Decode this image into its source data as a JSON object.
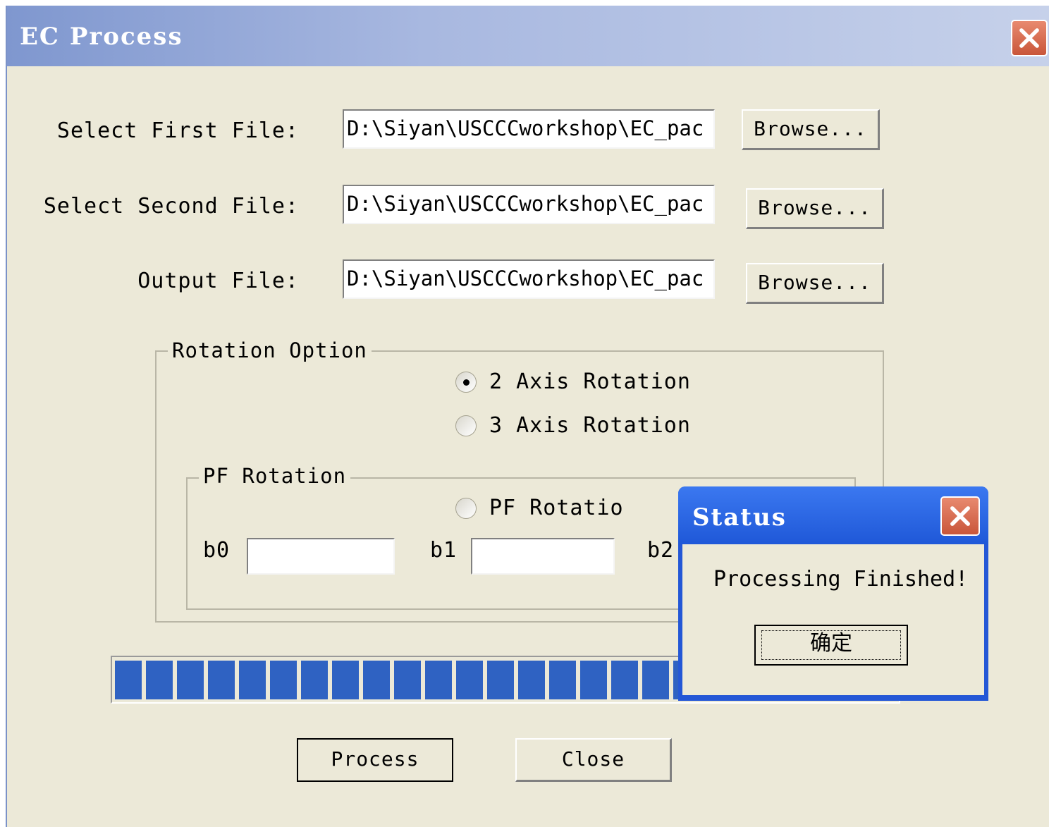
{
  "window": {
    "title": "EC Process"
  },
  "files": [
    {
      "label": "Select First File:",
      "value": "D:\\Siyan\\USCCCworkshop\\EC_pac",
      "browse_label": "Browse..."
    },
    {
      "label": "Select Second File:",
      "value": "D:\\Siyan\\USCCCworkshop\\EC_pac",
      "browse_label": "Browse..."
    },
    {
      "label": "Output File:",
      "value": "D:\\Siyan\\USCCCworkshop\\EC_pac",
      "browse_label": "Browse..."
    }
  ],
  "rotation": {
    "group_title": "Rotation Option",
    "options": [
      {
        "label": "2 Axis Rotation",
        "selected": true
      },
      {
        "label": "3 Axis Rotation",
        "selected": false
      }
    ],
    "pf": {
      "group_title": "PF Rotation",
      "option_label": "PF Rotatio",
      "b0_label": "b0",
      "b1_label": "b1",
      "b2_label": "b2",
      "b0_value": "",
      "b1_value": ""
    }
  },
  "progress": {
    "fraction": 1.0
  },
  "actions": {
    "process_label": "Process",
    "close_label": "Close"
  },
  "status_dialog": {
    "title": "Status",
    "message": "Processing Finished!",
    "ok_label": "确定"
  }
}
